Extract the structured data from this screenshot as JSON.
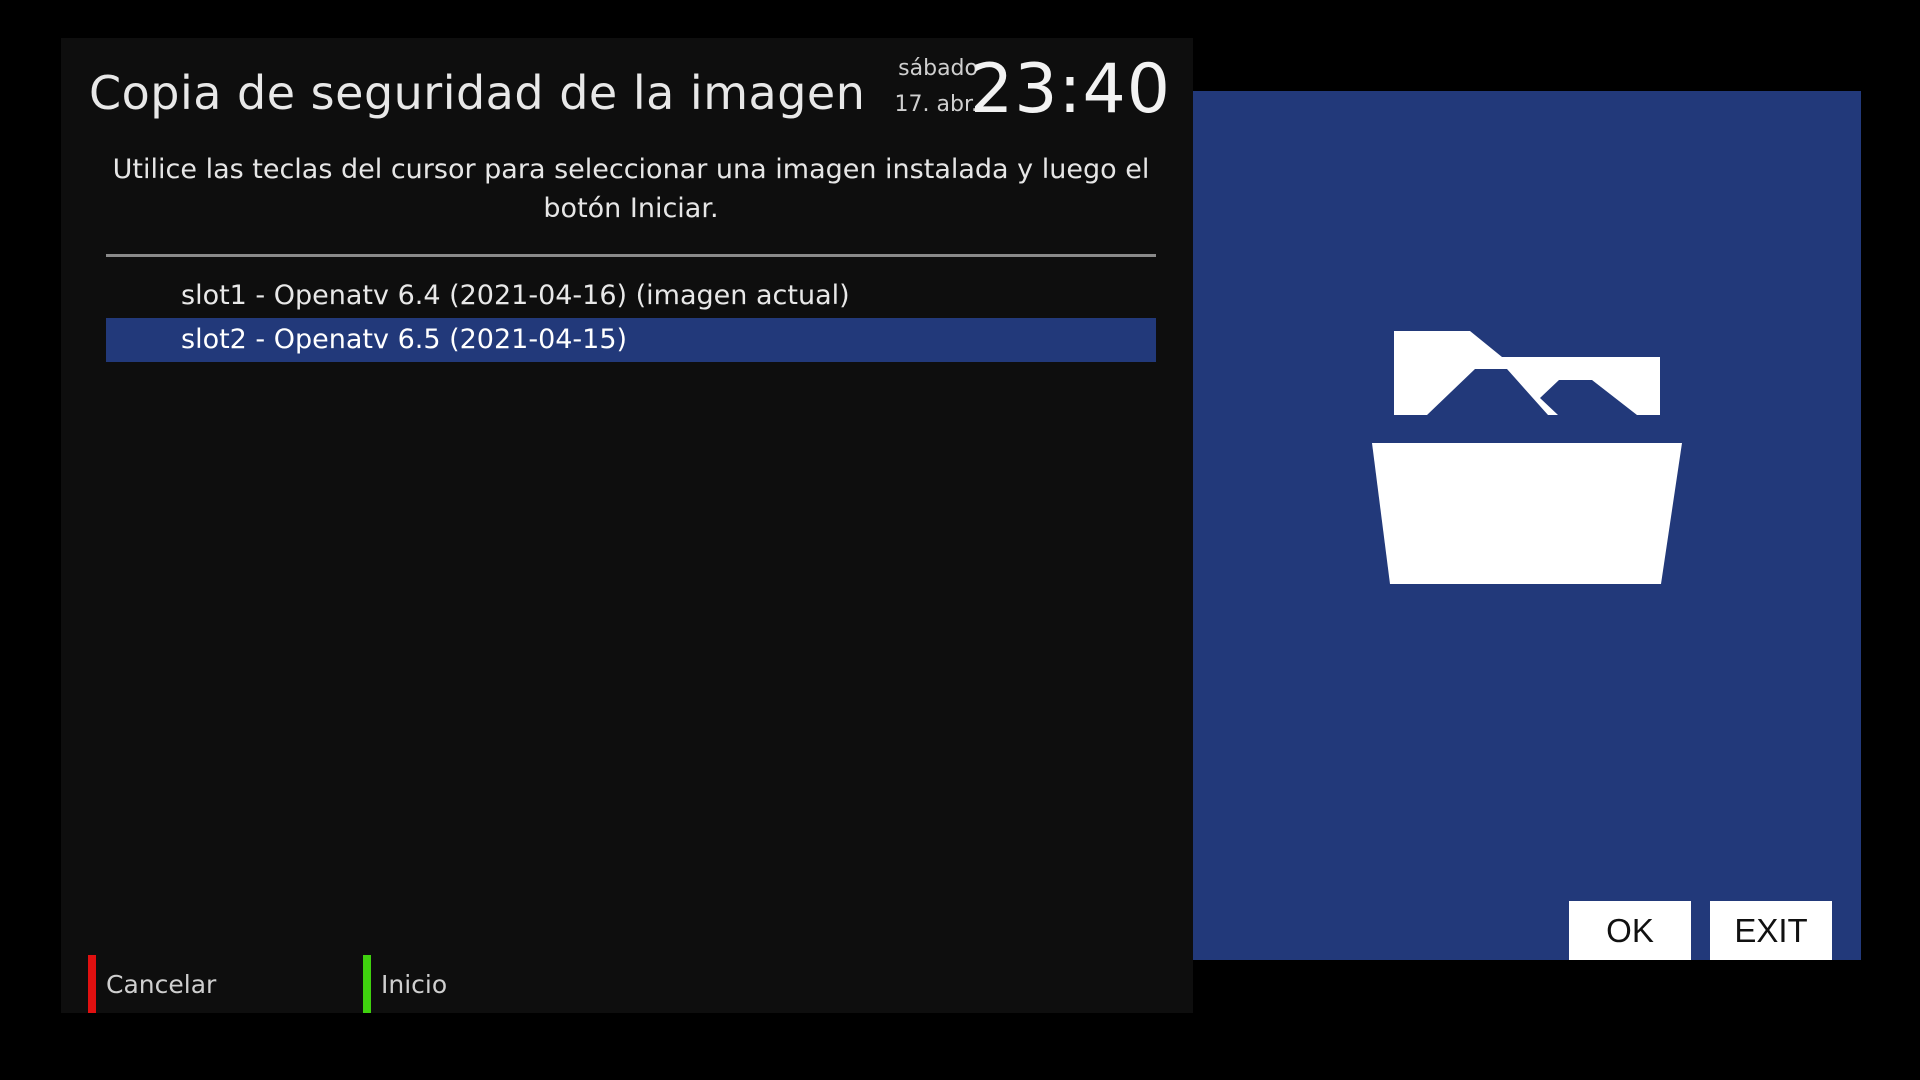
{
  "header": {
    "title": "Copia de seguridad de la imagen",
    "day": "sábado",
    "date": "17. abr.",
    "time": "23:40"
  },
  "instructions": "Utilice las teclas del cursor para seleccionar una imagen instalada y luego el botón Iniciar.",
  "images": [
    {
      "label": "slot1 - Openatv 6.4 (2021-04-16) (imagen actual)",
      "selected": false
    },
    {
      "label": "slot2 - Openatv 6.5 (2021-04-15)",
      "selected": true
    }
  ],
  "color_keys": {
    "red": {
      "label": "Cancelar",
      "color": "#e01010"
    },
    "green": {
      "label": "Inicio",
      "color": "#3fd10e"
    }
  },
  "side_panel": {
    "icon": "folder-open-icon",
    "background": "#22397a",
    "ok_label": "OK",
    "exit_label": "EXIT"
  }
}
